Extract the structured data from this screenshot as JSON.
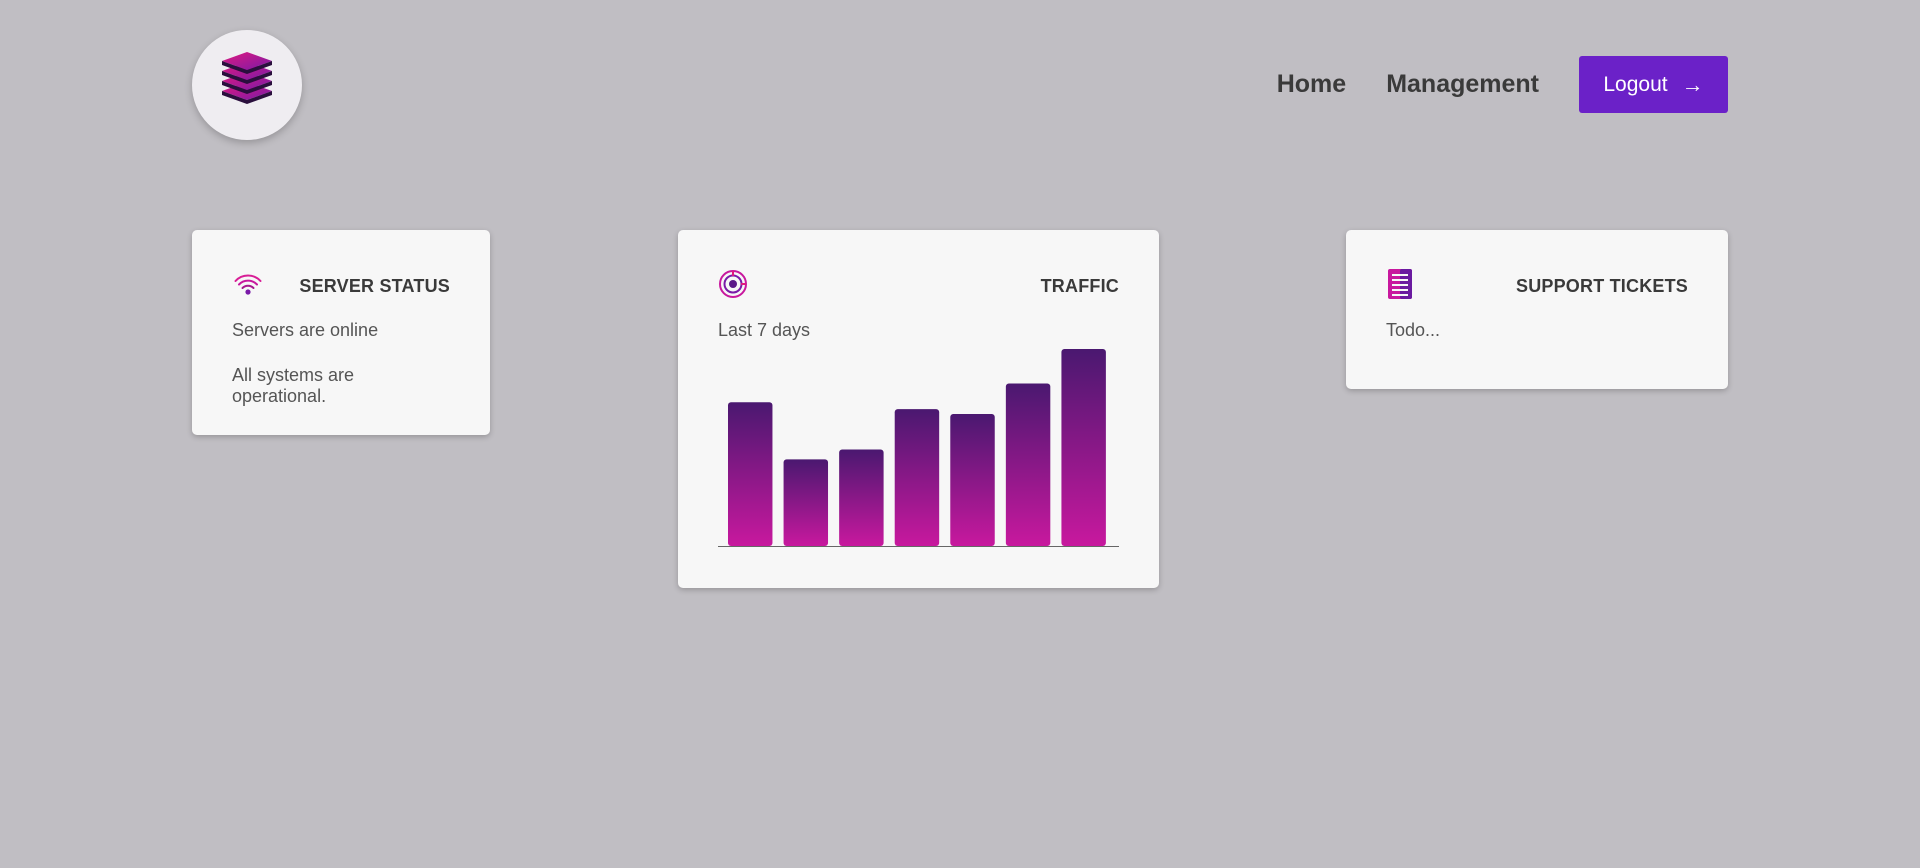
{
  "header": {
    "logo_icon": "layers-stack-icon",
    "nav": [
      {
        "label": "Home"
      },
      {
        "label": "Management"
      }
    ],
    "logout": {
      "label": "Logout",
      "arrow": "→"
    }
  },
  "cards": {
    "server": {
      "icon": "wifi-signal-icon",
      "title": "SERVER STATUS",
      "status": "Servers are online",
      "detail": "All systems are operational."
    },
    "traffic": {
      "icon": "globe-target-icon",
      "title": "TRAFFIC",
      "subtitle": "Last 7 days"
    },
    "support": {
      "icon": "ticket-list-icon",
      "title": "SUPPORT TICKETS",
      "text": "Todo..."
    }
  },
  "colors": {
    "background": "#c0bec3",
    "accent": "#6b21c8",
    "bar_top": "#4a1870",
    "bar_bottom": "#c8189e"
  },
  "chart_data": {
    "type": "bar",
    "categories": [
      "",
      "",
      "",
      "",
      "",
      "",
      ""
    ],
    "values": [
      146,
      88,
      98,
      139,
      134,
      165,
      200
    ],
    "ylim": [
      0,
      200
    ],
    "grid": false
  }
}
